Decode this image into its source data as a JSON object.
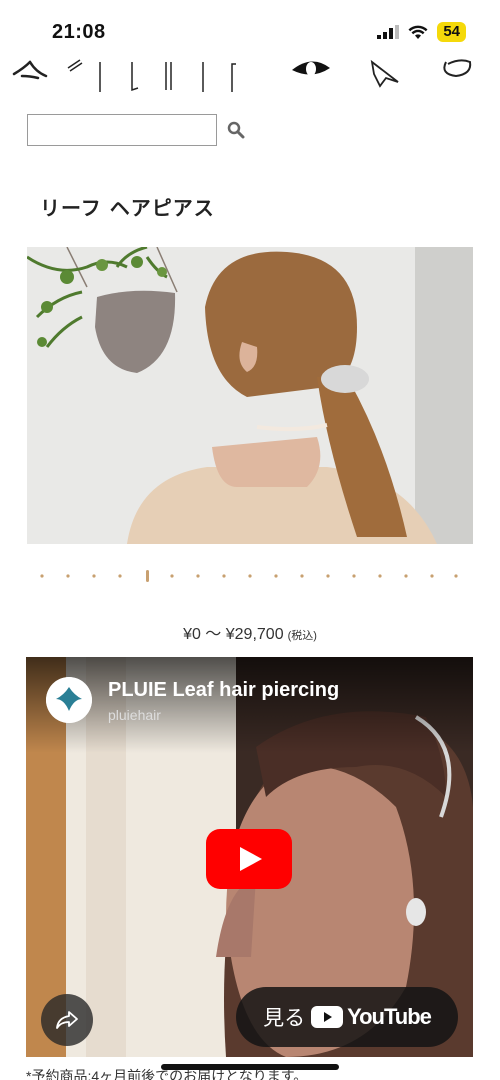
{
  "status_bar": {
    "time": "21:08",
    "battery": "54"
  },
  "search": {
    "placeholder": ""
  },
  "product": {
    "title": "リーフ ヘアピアス",
    "price": "¥0 〜 ¥29,700",
    "price_note": "(税込)"
  },
  "video": {
    "title": "PLUIE Leaf hair piercing",
    "channel": "pluiehair",
    "watch_label": "見る",
    "youtube_label": "YouTube"
  },
  "footnote": "*予約商品:4ヶ月前後でのお届けとなります。",
  "colors": {
    "accent_dots": "#c8a070",
    "play_red": "#ff0000",
    "battery_yellow": "#f5d90a"
  }
}
